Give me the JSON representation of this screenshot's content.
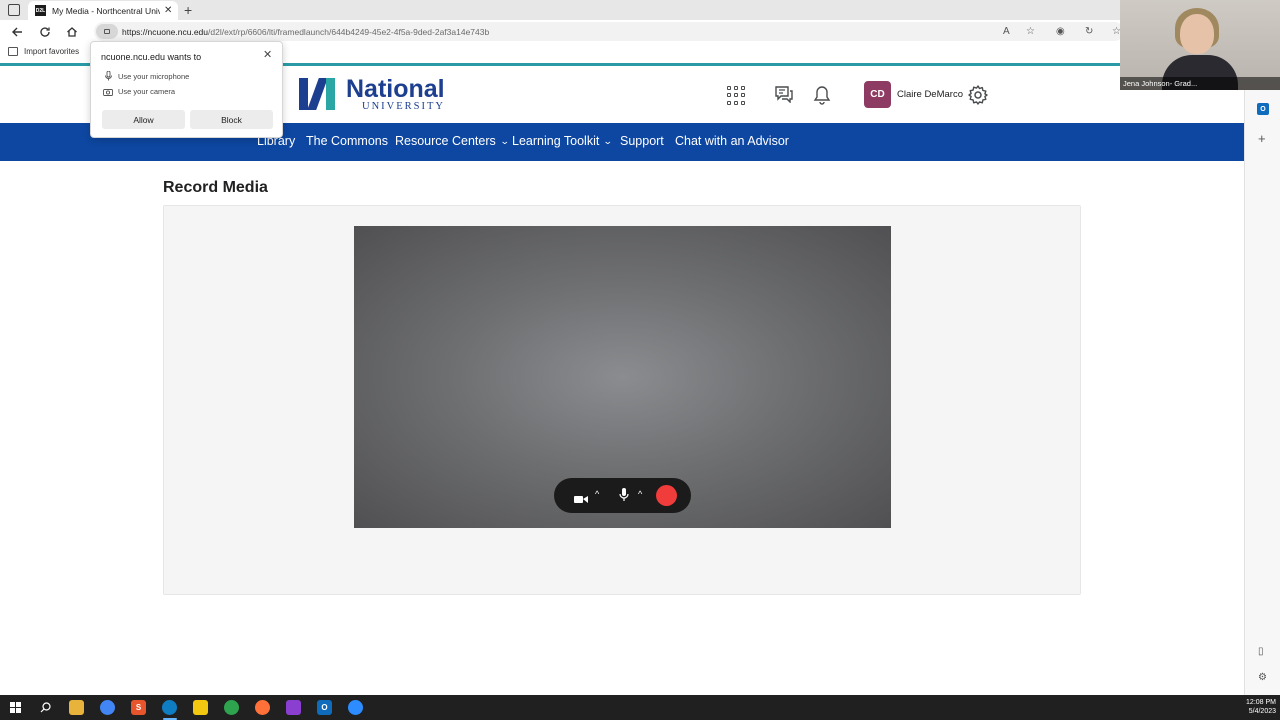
{
  "browser": {
    "tab_title": "My Media - Northcentral Univers",
    "tab_favicon_text": "D2L",
    "url_host": "https://ncuone.ncu.edu",
    "url_path": "/d2l/ext/rp/6606/lti/framedlaunch/644b4249-45e2-4f5a-9ded-2af3a14e743b",
    "favorites_bar": {
      "import_label": "Import favorites"
    }
  },
  "permission_prompt": {
    "title": "ncuone.ncu.edu wants to",
    "items": [
      {
        "label": "Use your microphone",
        "icon": "microphone-icon"
      },
      {
        "label": "Use your camera",
        "icon": "camera-icon"
      }
    ],
    "allow_label": "Allow",
    "block_label": "Block"
  },
  "header": {
    "logo": {
      "word": "National",
      "sub": "UNIVERSITY"
    },
    "user": {
      "initials": "CD",
      "name": "Claire DeMarco",
      "avatar_color": "#8e3b64"
    }
  },
  "nav": {
    "items": [
      {
        "label": "Library",
        "dropdown": false
      },
      {
        "label": "The Commons",
        "dropdown": false
      },
      {
        "label": "Resource Centers",
        "dropdown": true
      },
      {
        "label": "Learning Toolkit",
        "dropdown": true
      },
      {
        "label": "Support",
        "dropdown": false
      },
      {
        "label": "Chat with an Advisor",
        "dropdown": false
      }
    ],
    "chevron": "⌄",
    "bg_color": "#0d47a1"
  },
  "main": {
    "title": "Record Media",
    "record_button_color": "#f13c3c"
  },
  "video_overlay": {
    "name": "Jena Johnson- Grad..."
  },
  "taskbar": {
    "time": "12:08 PM",
    "date": "5/4/2023"
  },
  "colors": {
    "accent_teal": "#2a9aa6",
    "brand_blue": "#1d3f8f"
  }
}
